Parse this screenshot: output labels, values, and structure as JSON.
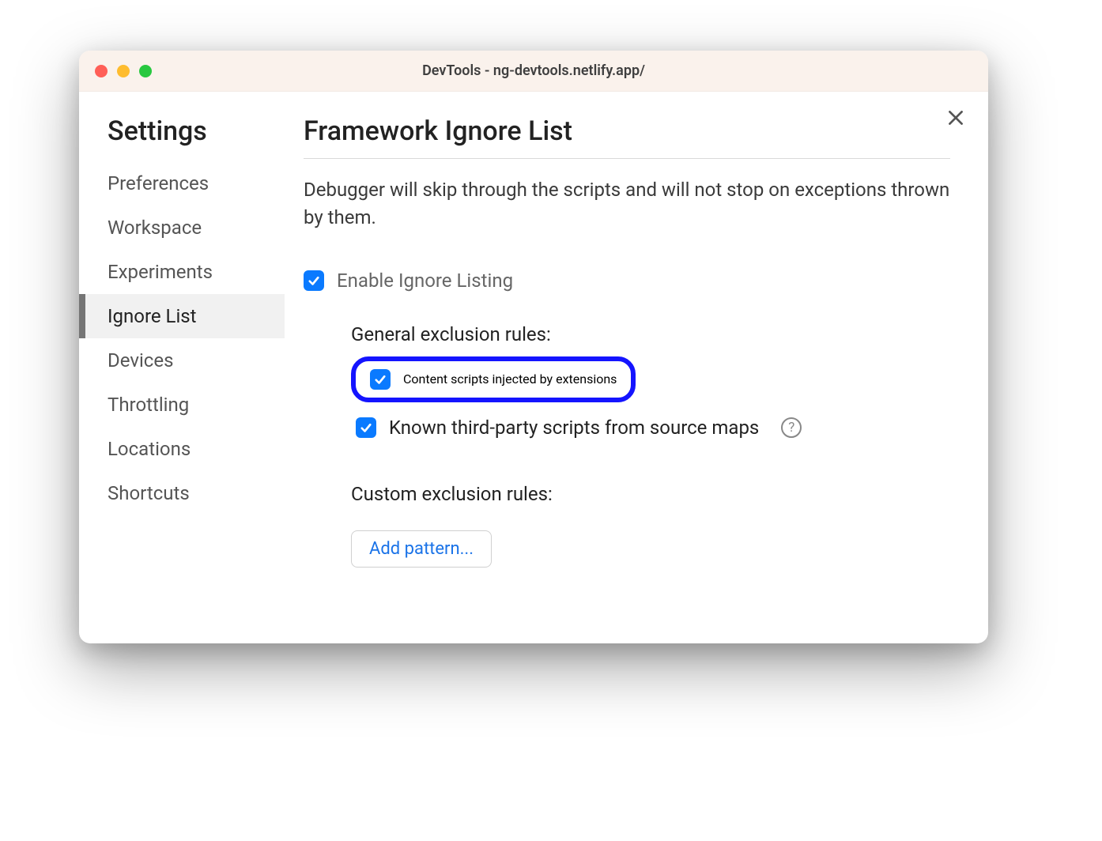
{
  "titlebar": {
    "title": "DevTools - ng-devtools.netlify.app/"
  },
  "sidebar": {
    "title": "Settings",
    "items": [
      {
        "label": "Preferences",
        "active": false
      },
      {
        "label": "Workspace",
        "active": false
      },
      {
        "label": "Experiments",
        "active": false
      },
      {
        "label": "Ignore List",
        "active": true
      },
      {
        "label": "Devices",
        "active": false
      },
      {
        "label": "Throttling",
        "active": false
      },
      {
        "label": "Locations",
        "active": false
      },
      {
        "label": "Shortcuts",
        "active": false
      }
    ]
  },
  "main": {
    "title": "Framework Ignore List",
    "description": "Debugger will skip through the scripts and will not stop on exceptions thrown by them.",
    "enable_label": "Enable Ignore Listing",
    "enable_checked": true,
    "general_rules_label": "General exclusion rules:",
    "rule_content_scripts": {
      "label": "Content scripts injected by extensions",
      "checked": true,
      "highlighted": true
    },
    "rule_third_party": {
      "label": "Known third-party scripts from source maps",
      "checked": true,
      "help": true
    },
    "custom_rules_label": "Custom exclusion rules:",
    "add_pattern_label": "Add pattern..."
  },
  "colors": {
    "checkbox_blue": "#0a7aff",
    "highlight_border": "#1414ff",
    "link_blue": "#1a73e8"
  }
}
